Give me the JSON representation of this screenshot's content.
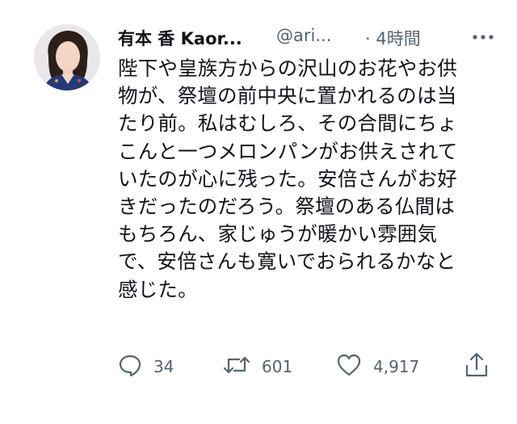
{
  "tweet": {
    "author_name": "有本 香 Kaor...",
    "author_handle": "@ari...",
    "time": "· 4時間",
    "text": "陛下や皇族方からの沢山のお花やお供\n物が、祭壇の前中央に置かれるのは当\nたり前。私はむしろ、その合間にちょ\nこんと一つメロンパンがお供えされて\nいたのが心に残った。安倍さんがお好\nきだったのだろう。祭壇のある仏間は\nもちろん、家じゅうが暖かい雰囲気\nで、安倍さんも寛いでおられるかなと\n感じた。"
  },
  "actions": {
    "reply_count": "34",
    "retweet_count": "601",
    "like_count": "4,917"
  },
  "icons": {
    "more": "more-dots-icon",
    "reply": "reply-icon",
    "retweet": "retweet-icon",
    "like": "heart-icon",
    "share": "share-icon"
  },
  "colors": {
    "text": "#0f1419",
    "secondary": "#536471"
  }
}
